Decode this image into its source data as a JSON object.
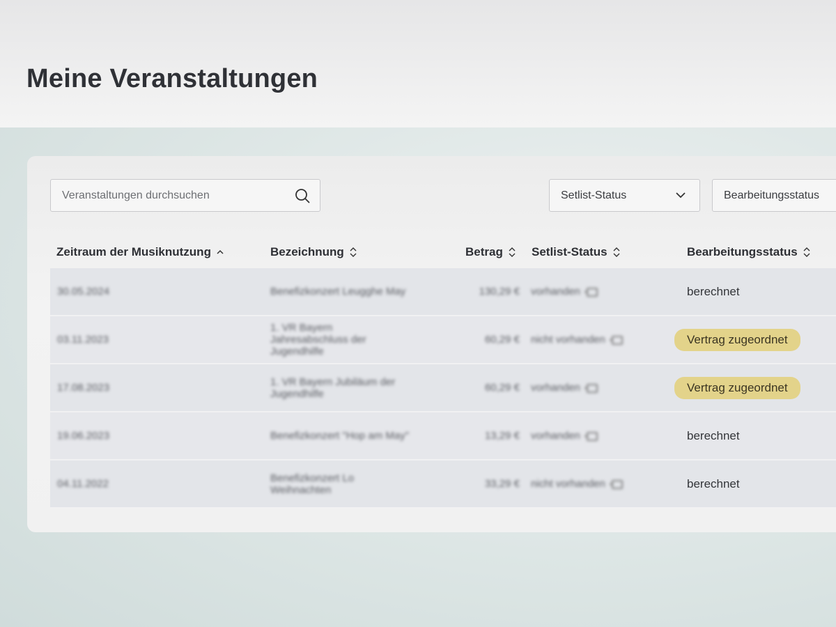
{
  "page": {
    "title": "Meine Veranstaltungen"
  },
  "search": {
    "placeholder": "Veranstaltungen durchsuchen"
  },
  "filters": [
    {
      "label": "Setlist-Status"
    },
    {
      "label": "Bearbeitungsstatus"
    }
  ],
  "table": {
    "headers": [
      "Zeitraum der Musiknutzung",
      "Bezeichnung",
      "Betrag",
      "Setlist-Status",
      "Bearbeitungsstatus"
    ],
    "sort": {
      "column": "Zeitraum der Musiknutzung",
      "direction": "ascending"
    },
    "rows": [
      {
        "date": "30.05.2024",
        "name": "Benefizkonzert Leugghe May",
        "amount": "130,29 €",
        "setlist": "vorhanden",
        "status": "berechnet",
        "status_type": "text"
      },
      {
        "date": "03.11.2023",
        "name": "1. VR Bayern Jahresabschluss der Jugendhilfe",
        "amount": "60,29 €",
        "setlist": "nicht vorhanden",
        "status": "Vertrag zugeordnet",
        "status_type": "badge"
      },
      {
        "date": "17.08.2023",
        "name": "1. VR Bayern Jubiläum der Jugendhilfe",
        "amount": "60,29 €",
        "setlist": "vorhanden",
        "status": "Vertrag zugeordnet",
        "status_type": "badge"
      },
      {
        "date": "19.06.2023",
        "name": "Benefizkonzert \"Hop am May\"",
        "amount": "13,29 €",
        "setlist": "vorhanden",
        "status": "berechnet",
        "status_type": "text"
      },
      {
        "date": "04.11.2022",
        "name": "Benefizkonzert Lo Weihnachten",
        "amount": "33,29 €",
        "setlist": "nicht vorhanden",
        "status": "berechnet",
        "status_type": "text"
      }
    ]
  },
  "colors": {
    "badge": "#e3d38a",
    "row": "#e3e5e9",
    "panel": "#f1f1f1"
  },
  "icons": {
    "search": "search-icon",
    "dropdown": "chevron-down-icon",
    "sort": "sort-icon",
    "setlist": "setlist-icon"
  }
}
